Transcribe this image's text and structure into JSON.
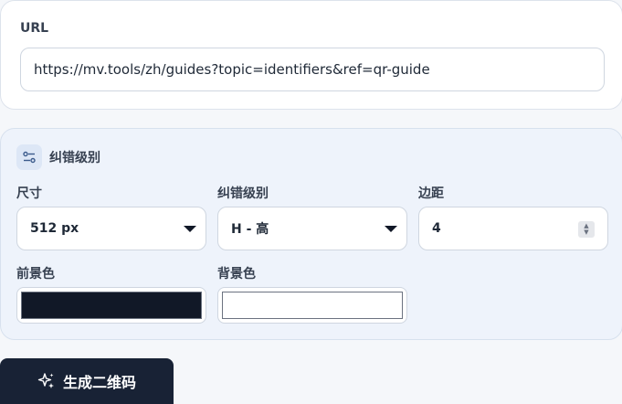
{
  "url_section": {
    "label": "URL",
    "value": "https://mv.tools/zh/guides?topic=identifiers&ref=qr-guide"
  },
  "settings": {
    "title": "纠错级别",
    "icon": "sliders-icon",
    "size": {
      "label": "尺寸",
      "value": "512 px"
    },
    "error_level": {
      "label": "纠错级别",
      "value": "H - 高"
    },
    "margin": {
      "label": "边距",
      "value": "4"
    },
    "foreground": {
      "label": "前景色",
      "color": "#111827"
    },
    "background": {
      "label": "背景色",
      "color": "#ffffff"
    }
  },
  "generate_button": {
    "label": "生成二维码",
    "icon": "sparkle-icon"
  },
  "colors": {
    "page_bg": "#f5f7fa",
    "settings_bg": "#eef3fb",
    "button_bg": "#182235"
  }
}
